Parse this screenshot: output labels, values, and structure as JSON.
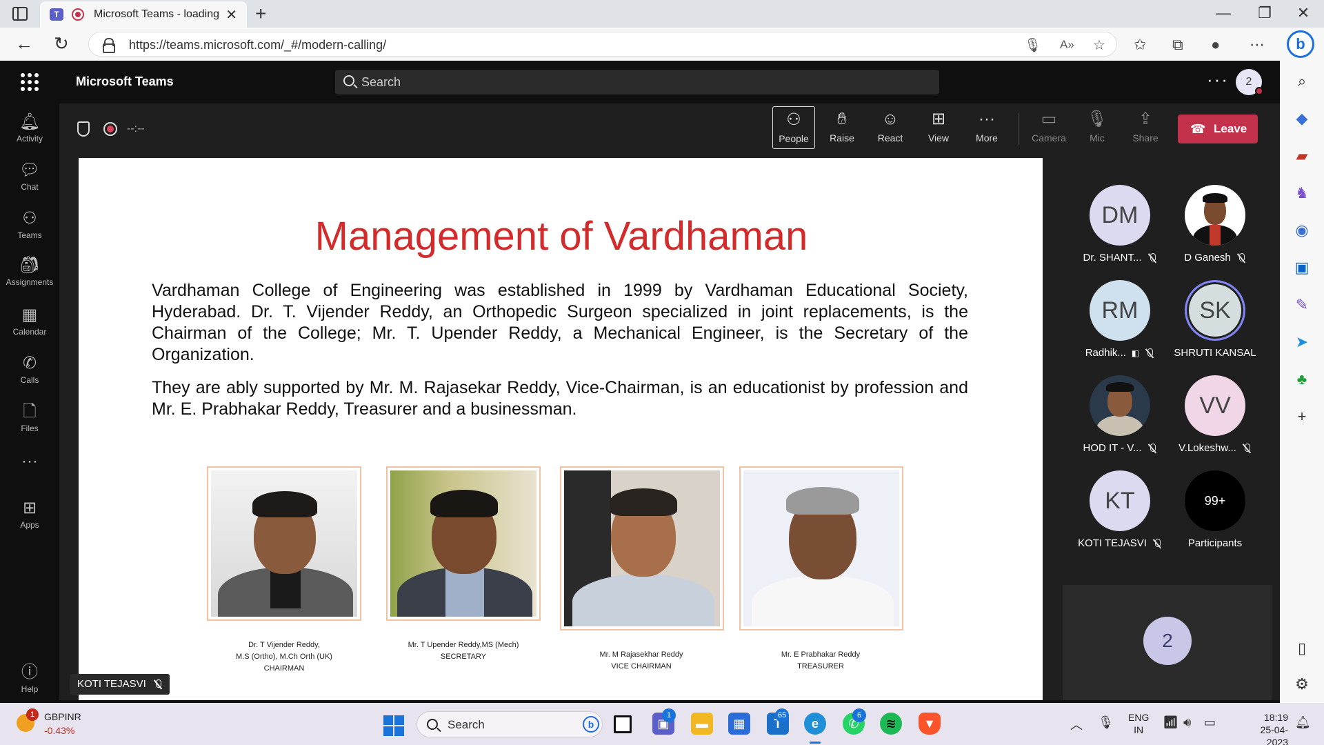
{
  "browser": {
    "tab_title": "Microsoft Teams - loading",
    "url": "https://teams.microsoft.com/_#/modern-calling/"
  },
  "teams": {
    "app_title": "Microsoft Teams",
    "search_placeholder": "Search",
    "avatar_count": "2",
    "rail": [
      {
        "label": "Activity",
        "icon": "bell-icon"
      },
      {
        "label": "Chat",
        "icon": "chat-icon"
      },
      {
        "label": "Teams",
        "icon": "teams-icon"
      },
      {
        "label": "Assignments",
        "icon": "assignments-icon"
      },
      {
        "label": "Calendar",
        "icon": "calendar-icon"
      },
      {
        "label": "Calls",
        "icon": "phone-icon"
      },
      {
        "label": "Files",
        "icon": "file-icon"
      },
      {
        "label": "Apps",
        "icon": "apps-icon"
      },
      {
        "label": "Help",
        "icon": "help-icon"
      }
    ],
    "meeting": {
      "timer": "--:--",
      "buttons": [
        {
          "label": "People",
          "icon": "people-icon",
          "active": true
        },
        {
          "label": "Raise",
          "icon": "hand-icon"
        },
        {
          "label": "React",
          "icon": "smile-icon"
        },
        {
          "label": "View",
          "icon": "grid-icon"
        },
        {
          "label": "More",
          "icon": "more-icon"
        },
        {
          "label": "Camera",
          "icon": "camera-off-icon",
          "disabled": true
        },
        {
          "label": "Mic",
          "icon": "mic-off-icon",
          "disabled": true
        },
        {
          "label": "Share",
          "icon": "share-icon",
          "disabled": true
        }
      ],
      "leave_label": "Leave",
      "presenter_name": "KOTI TEJASVI"
    },
    "participants": [
      {
        "initials": "DM",
        "name": "Dr. SHANT...",
        "muted": true,
        "color": "#dcdaf0"
      },
      {
        "initials": "",
        "name": "D Ganesh",
        "muted": true,
        "photo": true
      },
      {
        "initials": "RM",
        "name": "Radhik...",
        "muted": true,
        "color": "#cfe0ee"
      },
      {
        "initials": "SK",
        "name": "SHRUTI KANSAL",
        "muted": false,
        "color": "#d4dede",
        "speaking": true
      },
      {
        "initials": "",
        "name": "HOD IT - V...",
        "muted": true,
        "photo": true
      },
      {
        "initials": "VV",
        "name": "V.Lokeshw...",
        "muted": true,
        "color": "#f0d6e6"
      },
      {
        "initials": "KT",
        "name": "KOTI TEJASVI",
        "muted": true,
        "color": "#dcdaf0"
      },
      {
        "initials": "99+",
        "name": "Participants",
        "muted": false,
        "overflow": true
      }
    ],
    "gallery_count": "2"
  },
  "slide": {
    "title": "Management of Vardhaman",
    "paragraph1": "Vardhaman College of Engineering was established in 1999 by Vardhaman Educational Society, Hyderabad. Dr. T. Vijender Reddy, an Orthopedic Surgeon specialized in joint replacements, is the Chairman of the College; Mr. T. Upender Reddy, a Mechanical Engineer, is the Secretary of the Organization.",
    "paragraph2": "They are ably supported by Mr. M. Rajasekar Reddy, Vice-Chairman, is an educationist by profession and Mr. E. Prabhakar Reddy, Treasurer and a businessman.",
    "people": [
      {
        "line1": "Dr. T Vijender Reddy,",
        "line2": "M.S (Ortho), M.Ch Orth (UK)",
        "line3": "CHAIRMAN"
      },
      {
        "line1": "Mr. T Upender Reddy,MS (Mech)",
        "line2": "SECRETARY",
        "line3": ""
      },
      {
        "line1": "Mr. M Rajasekhar Reddy",
        "line2": "VICE CHAIRMAN",
        "line3": ""
      },
      {
        "line1": "Mr. E Prabhakar Reddy",
        "line2": "TREASURER",
        "line3": ""
      }
    ]
  },
  "taskbar": {
    "stock_name": "GBPINR",
    "stock_change": "-0.43%",
    "stock_badge": "1",
    "search_label": "Search",
    "teams_badge": "1",
    "store_badge": "65",
    "whatsapp_badge": "6",
    "lang_line1": "ENG",
    "lang_line2": "IN",
    "time": "18:19",
    "date": "25-04-2023"
  }
}
